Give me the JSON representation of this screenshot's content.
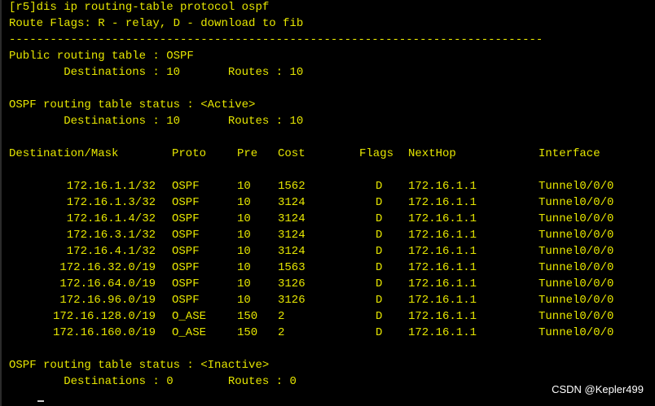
{
  "terminal": {
    "command_line": "[r5]dis ip routing-table protocol ospf",
    "flags_line": "Route Flags: R - relay, D - download to fib",
    "separator": "------------------------------------------------------------------------------",
    "public_title": "Public routing table : OSPF",
    "public_summary": "        Destinations : 10       Routes : 10",
    "active_title": "OSPF routing table status : <Active>",
    "active_summary": "        Destinations : 10       Routes : 10",
    "inactive_title": "OSPF routing table status : <Inactive>",
    "inactive_summary": "        Destinations : 0        Routes : 0",
    "headers": {
      "dest": "Destination/Mask",
      "proto": "Proto",
      "pre": "Pre",
      "cost": "Cost",
      "flags": "Flags",
      "nexthop": "NextHop",
      "iface": "Interface"
    },
    "routes": [
      {
        "dest": "172.16.1.1/32",
        "proto": "OSPF",
        "pre": "10",
        "cost": "1562",
        "flags": "D",
        "nexthop": "172.16.1.1",
        "iface": "Tunnel0/0/0"
      },
      {
        "dest": "172.16.1.3/32",
        "proto": "OSPF",
        "pre": "10",
        "cost": "3124",
        "flags": "D",
        "nexthop": "172.16.1.1",
        "iface": "Tunnel0/0/0"
      },
      {
        "dest": "172.16.1.4/32",
        "proto": "OSPF",
        "pre": "10",
        "cost": "3124",
        "flags": "D",
        "nexthop": "172.16.1.1",
        "iface": "Tunnel0/0/0"
      },
      {
        "dest": "172.16.3.1/32",
        "proto": "OSPF",
        "pre": "10",
        "cost": "3124",
        "flags": "D",
        "nexthop": "172.16.1.1",
        "iface": "Tunnel0/0/0"
      },
      {
        "dest": "172.16.4.1/32",
        "proto": "OSPF",
        "pre": "10",
        "cost": "3124",
        "flags": "D",
        "nexthop": "172.16.1.1",
        "iface": "Tunnel0/0/0"
      },
      {
        "dest": "172.16.32.0/19",
        "proto": "OSPF",
        "pre": "10",
        "cost": "1563",
        "flags": "D",
        "nexthop": "172.16.1.1",
        "iface": "Tunnel0/0/0"
      },
      {
        "dest": "172.16.64.0/19",
        "proto": "OSPF",
        "pre": "10",
        "cost": "3126",
        "flags": "D",
        "nexthop": "172.16.1.1",
        "iface": "Tunnel0/0/0"
      },
      {
        "dest": "172.16.96.0/19",
        "proto": "OSPF",
        "pre": "10",
        "cost": "3126",
        "flags": "D",
        "nexthop": "172.16.1.1",
        "iface": "Tunnel0/0/0"
      },
      {
        "dest": "172.16.128.0/19",
        "proto": "O_ASE",
        "pre": "150",
        "cost": "2",
        "flags": "D",
        "nexthop": "172.16.1.1",
        "iface": "Tunnel0/0/0"
      },
      {
        "dest": "172.16.160.0/19",
        "proto": "O_ASE",
        "pre": "150",
        "cost": "2",
        "flags": "D",
        "nexthop": "172.16.1.1",
        "iface": "Tunnel0/0/0"
      }
    ]
  },
  "watermark": "CSDN @Kepler499",
  "colors": {
    "background": "#000000",
    "text": "#e6e600",
    "watermark": "#ffffff"
  }
}
